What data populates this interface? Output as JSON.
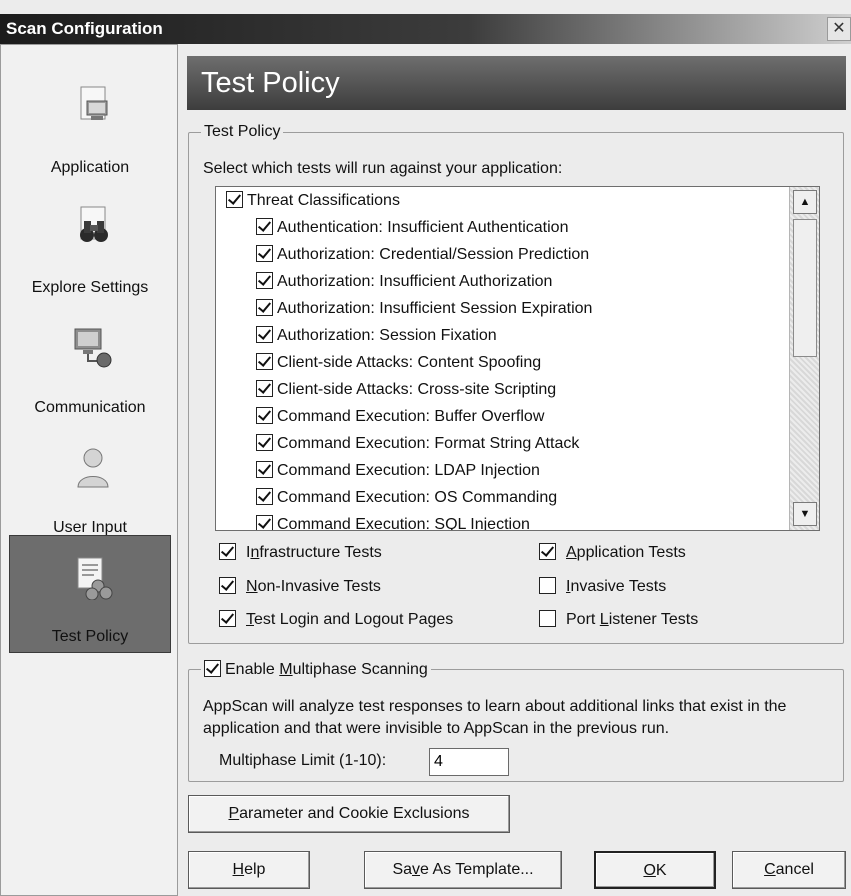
{
  "window": {
    "title": "Scan Configuration",
    "close_glyph": "✕"
  },
  "sidebar": {
    "items": [
      {
        "label": "Application",
        "icon": "application-icon",
        "active": false
      },
      {
        "label": "Explore Settings",
        "icon": "binoculars-icon",
        "active": false
      },
      {
        "label": "Communication",
        "icon": "network-computer-icon",
        "active": false
      },
      {
        "label": "User Input",
        "icon": "user-icon",
        "active": false
      },
      {
        "label": "Test Policy",
        "icon": "policy-document-icon",
        "active": true
      }
    ]
  },
  "header": {
    "title": "Test Policy"
  },
  "test_policy": {
    "group_label": "Test Policy",
    "instruction": "Select which tests will run against your application:",
    "tree": {
      "root": {
        "label": "Threat Classifications",
        "checked": true
      },
      "children": [
        {
          "label": "Authentication: Insufficient Authentication",
          "checked": true
        },
        {
          "label": "Authorization: Credential/Session Prediction",
          "checked": true
        },
        {
          "label": "Authorization: Insufficient Authorization",
          "checked": true
        },
        {
          "label": "Authorization: Insufficient Session Expiration",
          "checked": true
        },
        {
          "label": "Authorization: Session Fixation",
          "checked": true
        },
        {
          "label": "Client-side Attacks: Content Spoofing",
          "checked": true
        },
        {
          "label": "Client-side Attacks: Cross-site Scripting",
          "checked": true
        },
        {
          "label": "Command Execution: Buffer Overflow",
          "checked": true
        },
        {
          "label": "Command Execution: Format String Attack",
          "checked": true
        },
        {
          "label": "Command Execution: LDAP Injection",
          "checked": true
        },
        {
          "label": "Command Execution: OS Commanding",
          "checked": true
        },
        {
          "label": "Command Execution: SQL Injection",
          "checked": true
        }
      ]
    },
    "options": {
      "infrastructure": {
        "pre": "I",
        "u": "n",
        "post": "frastructure Tests",
        "checked": true
      },
      "application": {
        "pre": "",
        "u": "A",
        "post": "pplication Tests",
        "checked": true
      },
      "non_invasive": {
        "pre": "",
        "u": "N",
        "post": "on-Invasive Tests",
        "checked": true
      },
      "invasive": {
        "pre": "",
        "u": "I",
        "post": "nvasive Tests",
        "checked": false
      },
      "login_logout": {
        "pre": "",
        "u": "T",
        "post": "est Login and Logout Pages",
        "checked": true
      },
      "port_listener": {
        "pre": "Port ",
        "u": "L",
        "post": "istener Tests",
        "checked": false
      }
    }
  },
  "multiphase": {
    "enable": {
      "pre": "Enable ",
      "u": "M",
      "post": "ultiphase Scanning",
      "checked": true
    },
    "description": "AppScan will analyze test responses to learn about additional links that exist in the application and that were invisible to AppScan in the previous run.",
    "limit_label": "Multiphase Limit (1-10):",
    "limit_value": "4"
  },
  "buttons": {
    "exclusions": {
      "pre": "",
      "u": "P",
      "post": "arameter and Cookie Exclusions"
    },
    "help": {
      "pre": "",
      "u": "H",
      "post": "elp"
    },
    "save_template": {
      "pre": "Sa",
      "u": "v",
      "post": "e As Template..."
    },
    "ok": {
      "pre": "",
      "u": "O",
      "post": "K"
    },
    "cancel": {
      "pre": "",
      "u": "C",
      "post": "ancel"
    }
  }
}
